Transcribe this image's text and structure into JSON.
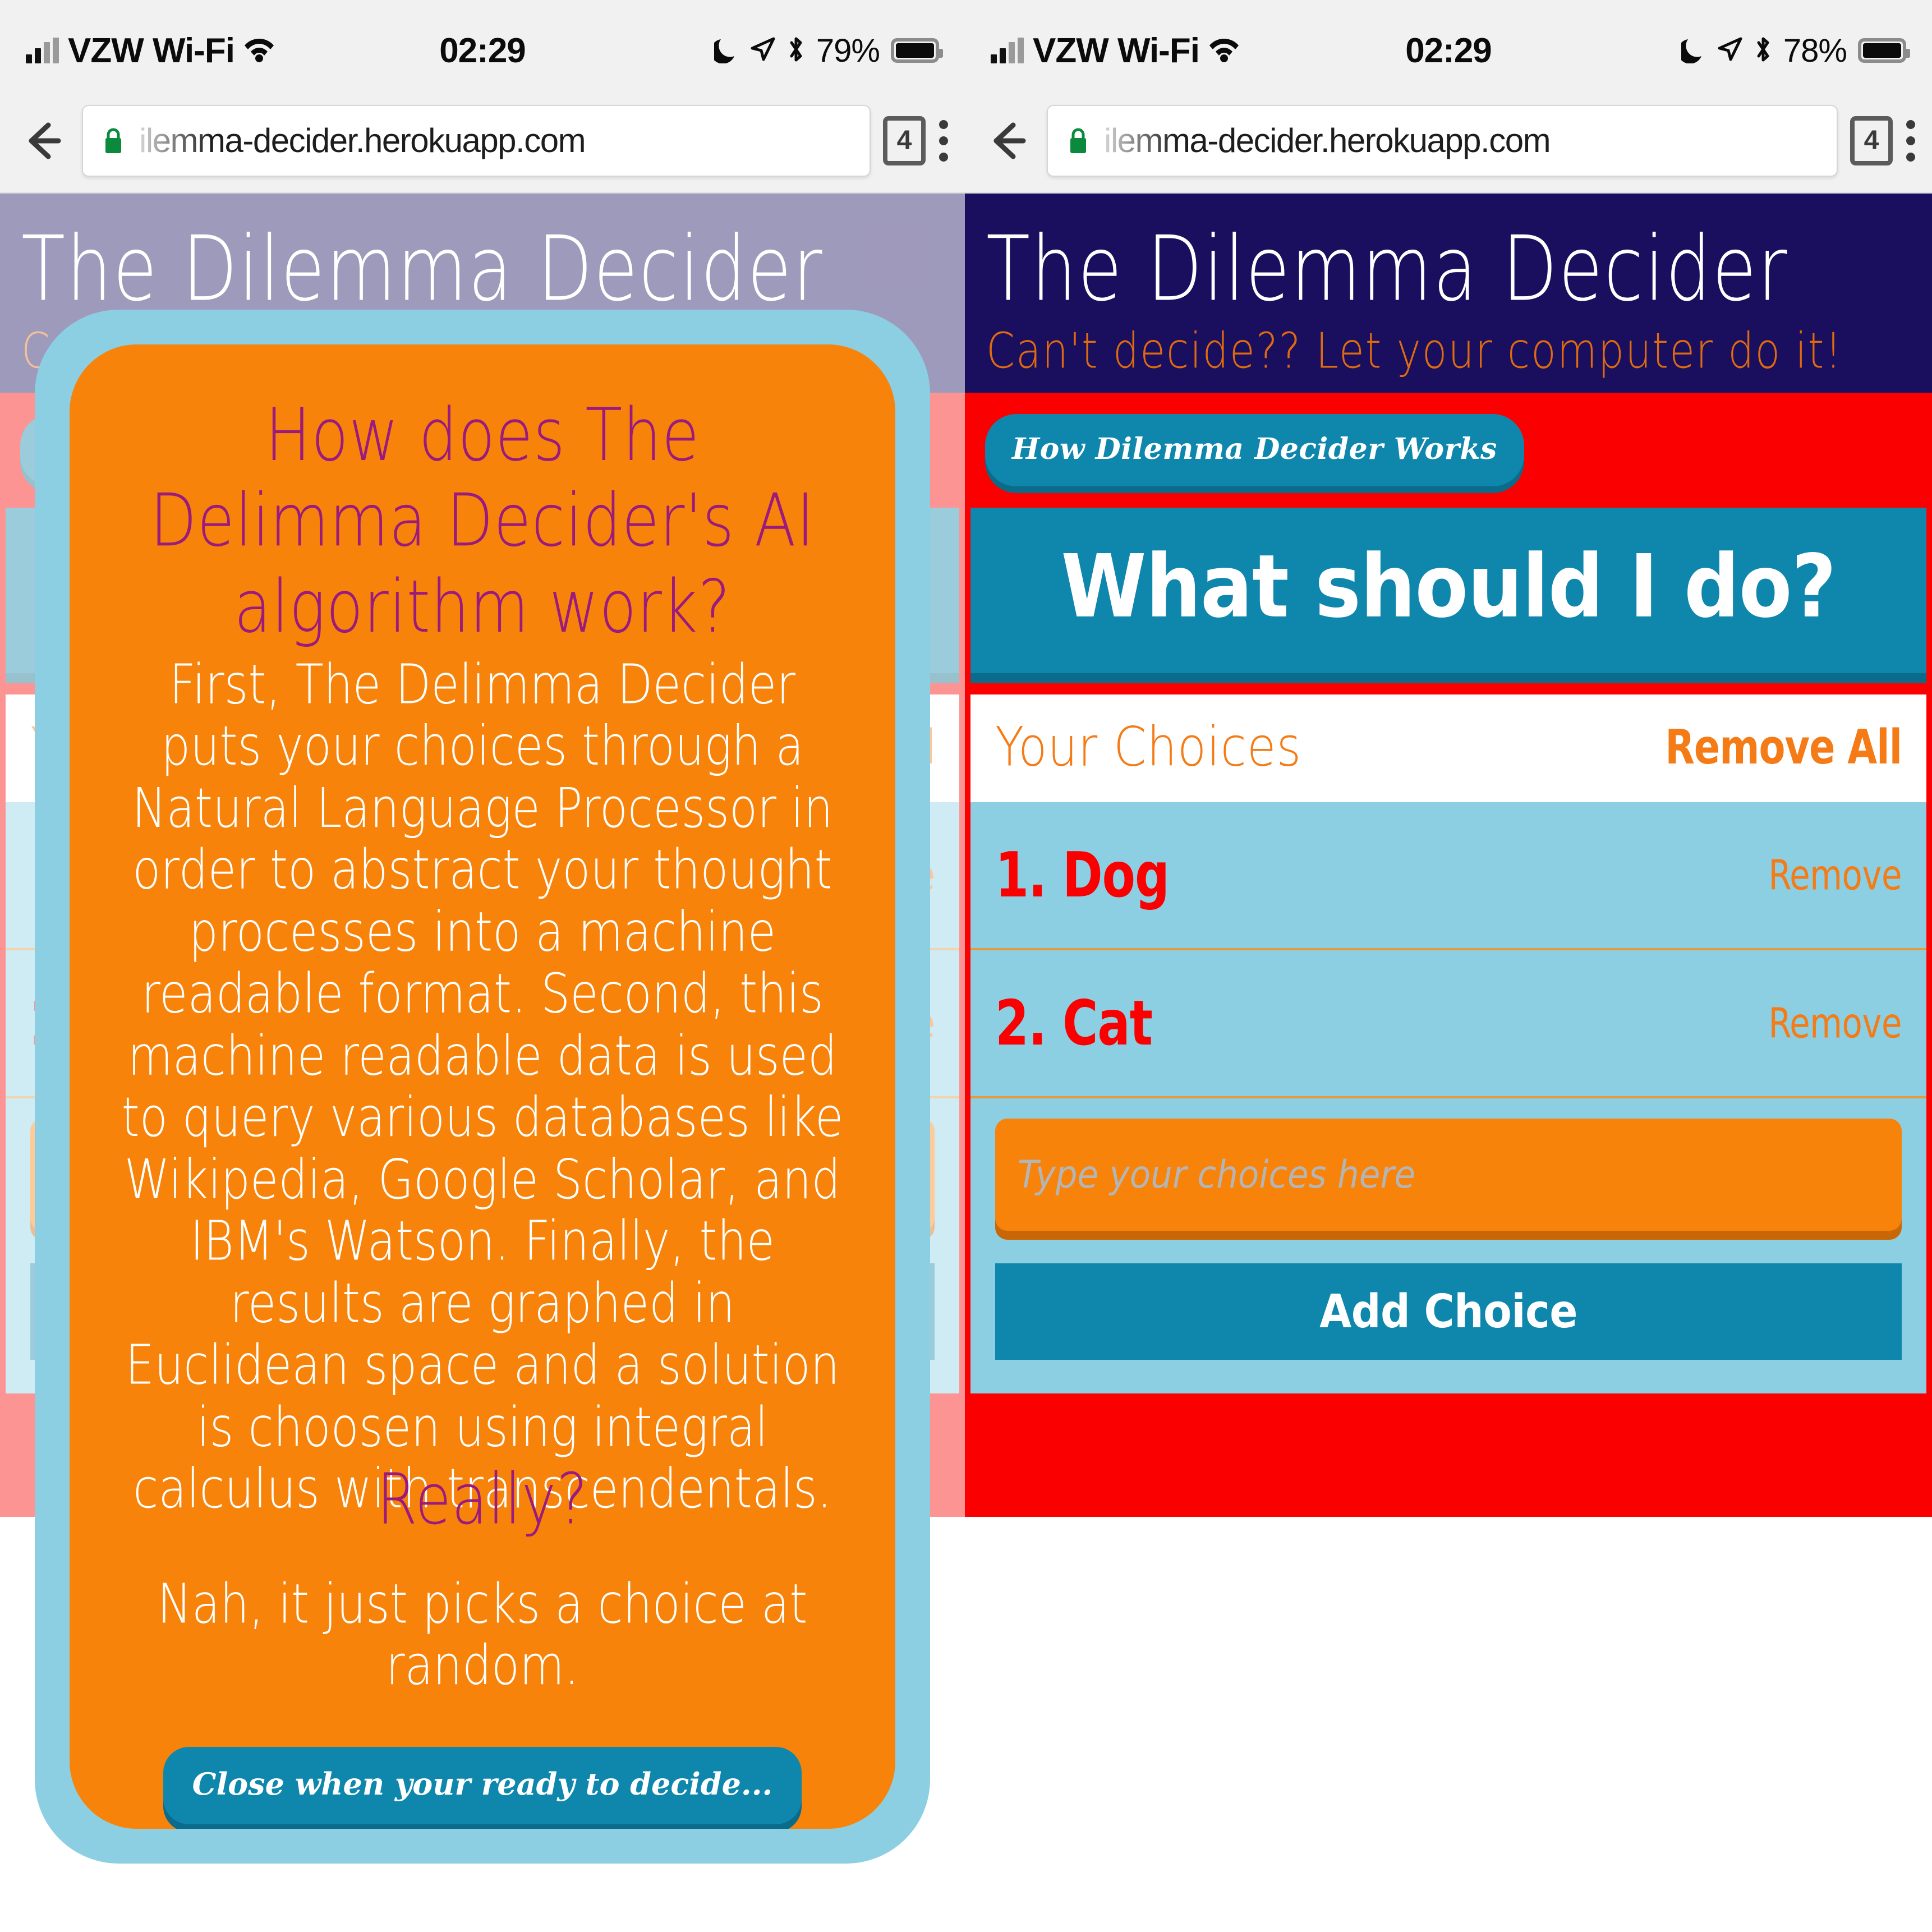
{
  "status_bar": {
    "carrier": "VZW Wi-Fi",
    "time": "02:29",
    "battery_left": "79%",
    "battery_right": "78%",
    "icons": [
      "signal-bars-icon",
      "wifi-icon",
      "moon-icon",
      "location-arrow-icon",
      "bluetooth-icon",
      "battery-icon"
    ]
  },
  "browser": {
    "url": "ilemma-decider.herokuapp.com",
    "tab_count": "4",
    "icons": [
      "back-arrow-icon",
      "lock-icon",
      "tabs-icon",
      "overflow-menu-icon"
    ]
  },
  "app": {
    "title": "The Dilemma Decider",
    "tagline": "Can't decide?? Let your computer do it!",
    "how_button": "How Dilemma Decider Works",
    "banner": "What should I do?"
  },
  "choices": {
    "heading": "Your Choices",
    "remove_all": "Remove All",
    "items": [
      {
        "label": "1. Dog",
        "remove": "Remove"
      },
      {
        "label": "2. Cat",
        "remove": "Remove"
      }
    ],
    "input_placeholder": "Type your choices here",
    "input_value": "",
    "add_button": "Add Choice"
  },
  "modal": {
    "title": "How does The Delimma Decider's AI algorithm work?",
    "body": "First, The Delimma Decider puts your choices through a Natural Language Processor in order to abstract your thought processes into a machine readable format. Second, this machine readable data is used to query various databases like Wikipedia, Google Scholar, and IBM's Watson. Finally, the results are graphed in Euclidean space and a solution is choosen using integral calculus with transcendentals.",
    "subtitle": "Really?",
    "footer": "Nah, it just picks a choice at random.",
    "close_button": "Close when your ready to decide..."
  },
  "colors": {
    "navy": "#1a0f5e",
    "red": "#fb0000",
    "teal": "#0f87ad",
    "orange": "#f7830a",
    "light_blue": "#8ccfe3",
    "purple": "#9a1a7e",
    "tagline_orange": "#e06a10"
  }
}
